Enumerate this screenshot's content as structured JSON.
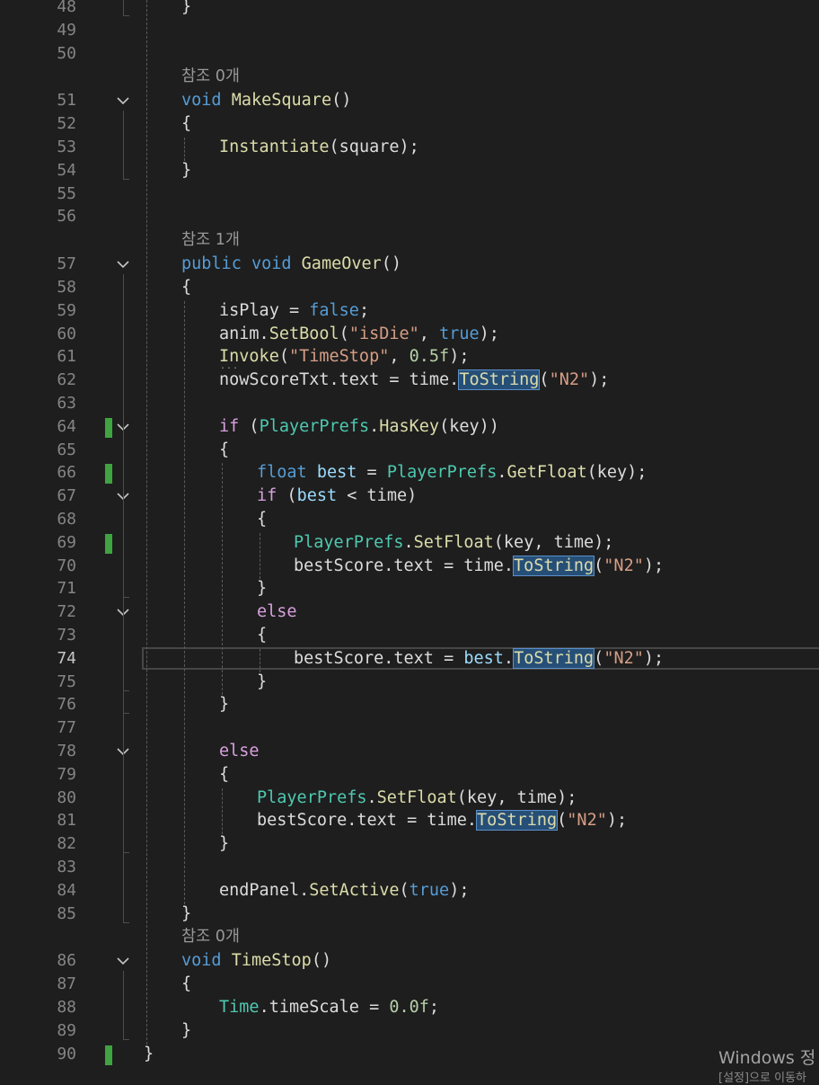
{
  "lines": [
    {
      "n": "48",
      "indent": 1,
      "tokens": [
        [
          "id",
          "}"
        ]
      ]
    },
    {
      "n": "49",
      "indent": 0,
      "tokens": []
    },
    {
      "n": "50",
      "indent": 0,
      "tokens": []
    },
    {
      "n": "51",
      "indent": 1,
      "fold": true,
      "lens": "참조 0개",
      "tokens": [
        [
          "kw",
          "void"
        ],
        [
          "id",
          " "
        ],
        [
          "fn",
          "MakeSquare"
        ],
        [
          "id",
          "()"
        ]
      ]
    },
    {
      "n": "52",
      "indent": 1,
      "tokens": [
        [
          "id",
          "{"
        ]
      ]
    },
    {
      "n": "53",
      "indent": 2,
      "tokens": [
        [
          "fn",
          "Instantiate"
        ],
        [
          "id",
          "(square);"
        ]
      ]
    },
    {
      "n": "54",
      "indent": 1,
      "tokens": [
        [
          "id",
          "}"
        ]
      ]
    },
    {
      "n": "55",
      "indent": 0,
      "tokens": []
    },
    {
      "n": "56",
      "indent": 0,
      "tokens": []
    },
    {
      "n": "57",
      "indent": 1,
      "fold": true,
      "lens": "참조 1개",
      "tokens": [
        [
          "kw",
          "public"
        ],
        [
          "id",
          " "
        ],
        [
          "kw",
          "void"
        ],
        [
          "id",
          " "
        ],
        [
          "fn",
          "GameOver"
        ],
        [
          "id",
          "()"
        ]
      ]
    },
    {
      "n": "58",
      "indent": 1,
      "tokens": [
        [
          "id",
          "{"
        ]
      ]
    },
    {
      "n": "59",
      "indent": 2,
      "tokens": [
        [
          "id",
          "isPlay = "
        ],
        [
          "kw",
          "false"
        ],
        [
          "id",
          ";"
        ]
      ]
    },
    {
      "n": "60",
      "indent": 2,
      "tokens": [
        [
          "id",
          "anim."
        ],
        [
          "fn",
          "SetBool"
        ],
        [
          "id",
          "("
        ],
        [
          "str",
          "\"isDie\""
        ],
        [
          "id",
          ", "
        ],
        [
          "kw",
          "true"
        ],
        [
          "id",
          ");"
        ]
      ]
    },
    {
      "n": "61",
      "indent": 2,
      "dots": true,
      "tokens": [
        [
          "fn",
          "Invoke"
        ],
        [
          "id",
          "("
        ],
        [
          "str",
          "\"TimeStop\""
        ],
        [
          "id",
          ", "
        ],
        [
          "num",
          "0.5f"
        ],
        [
          "id",
          ");"
        ]
      ]
    },
    {
      "n": "62",
      "indent": 2,
      "tokens": [
        [
          "id",
          "nowScoreTxt.text = time."
        ],
        [
          "fnhl",
          "ToString"
        ],
        [
          "id",
          "("
        ],
        [
          "str",
          "\"N2\""
        ],
        [
          "id",
          ");"
        ]
      ]
    },
    {
      "n": "63",
      "indent": 0,
      "tokens": []
    },
    {
      "n": "64",
      "indent": 2,
      "fold": true,
      "changed": true,
      "tokens": [
        [
          "ctl",
          "if"
        ],
        [
          "id",
          " ("
        ],
        [
          "ty",
          "PlayerPrefs"
        ],
        [
          "id",
          "."
        ],
        [
          "fn",
          "HasKey"
        ],
        [
          "id",
          "(key))"
        ]
      ]
    },
    {
      "n": "65",
      "indent": 2,
      "tokens": [
        [
          "id",
          "{"
        ]
      ]
    },
    {
      "n": "66",
      "indent": 3,
      "changed": true,
      "tokens": [
        [
          "kw",
          "float"
        ],
        [
          "id",
          " "
        ],
        [
          "var",
          "best"
        ],
        [
          "id",
          " = "
        ],
        [
          "ty",
          "PlayerPrefs"
        ],
        [
          "id",
          "."
        ],
        [
          "fn",
          "GetFloat"
        ],
        [
          "id",
          "(key);"
        ]
      ]
    },
    {
      "n": "67",
      "indent": 3,
      "fold": true,
      "tokens": [
        [
          "ctl",
          "if"
        ],
        [
          "id",
          " ("
        ],
        [
          "var",
          "best"
        ],
        [
          "id",
          " < time)"
        ]
      ]
    },
    {
      "n": "68",
      "indent": 3,
      "tokens": [
        [
          "id",
          "{"
        ]
      ]
    },
    {
      "n": "69",
      "indent": 4,
      "changed": true,
      "tokens": [
        [
          "ty",
          "PlayerPrefs"
        ],
        [
          "id",
          "."
        ],
        [
          "fn",
          "SetFloat"
        ],
        [
          "id",
          "(key, time);"
        ]
      ]
    },
    {
      "n": "70",
      "indent": 4,
      "tokens": [
        [
          "id",
          "bestScore.text = time."
        ],
        [
          "fnhl",
          "ToString"
        ],
        [
          "id",
          "("
        ],
        [
          "str",
          "\"N2\""
        ],
        [
          "id",
          ");"
        ]
      ]
    },
    {
      "n": "71",
      "indent": 3,
      "tokens": [
        [
          "id",
          "}"
        ]
      ]
    },
    {
      "n": "72",
      "indent": 3,
      "fold": true,
      "tokens": [
        [
          "ctl",
          "else"
        ]
      ]
    },
    {
      "n": "73",
      "indent": 3,
      "tokens": [
        [
          "id",
          "{"
        ]
      ]
    },
    {
      "n": "74",
      "indent": 4,
      "current": true,
      "tokens": [
        [
          "id",
          "bestScore.text = "
        ],
        [
          "var",
          "best"
        ],
        [
          "id",
          "."
        ],
        [
          "fnhl",
          "ToString"
        ],
        [
          "id",
          "("
        ],
        [
          "str",
          "\"N2\""
        ],
        [
          "id",
          ");"
        ]
      ]
    },
    {
      "n": "75",
      "indent": 3,
      "tokens": [
        [
          "id",
          "}"
        ]
      ]
    },
    {
      "n": "76",
      "indent": 2,
      "tokens": [
        [
          "id",
          "}"
        ]
      ]
    },
    {
      "n": "77",
      "indent": 0,
      "tokens": []
    },
    {
      "n": "78",
      "indent": 2,
      "fold": true,
      "tokens": [
        [
          "ctl",
          "else"
        ]
      ]
    },
    {
      "n": "79",
      "indent": 2,
      "tokens": [
        [
          "id",
          "{"
        ]
      ]
    },
    {
      "n": "80",
      "indent": 3,
      "tokens": [
        [
          "ty",
          "PlayerPrefs"
        ],
        [
          "id",
          "."
        ],
        [
          "fn",
          "SetFloat"
        ],
        [
          "id",
          "(key, time);"
        ]
      ]
    },
    {
      "n": "81",
      "indent": 3,
      "tokens": [
        [
          "id",
          "bestScore.text = time."
        ],
        [
          "fnhl",
          "ToString"
        ],
        [
          "id",
          "("
        ],
        [
          "str",
          "\"N2\""
        ],
        [
          "id",
          ");"
        ]
      ]
    },
    {
      "n": "82",
      "indent": 2,
      "tokens": [
        [
          "id",
          "}"
        ]
      ]
    },
    {
      "n": "83",
      "indent": 0,
      "tokens": []
    },
    {
      "n": "84",
      "indent": 2,
      "tokens": [
        [
          "id",
          "endPanel."
        ],
        [
          "fn",
          "SetActive"
        ],
        [
          "id",
          "("
        ],
        [
          "kw",
          "true"
        ],
        [
          "id",
          ");"
        ]
      ]
    },
    {
      "n": "85",
      "indent": 1,
      "tokens": [
        [
          "id",
          "}"
        ]
      ]
    },
    {
      "n": "86",
      "indent": 1,
      "fold": true,
      "lens": "참조 0개",
      "tokens": [
        [
          "kw",
          "void"
        ],
        [
          "id",
          " "
        ],
        [
          "fn",
          "TimeStop"
        ],
        [
          "id",
          "()"
        ]
      ]
    },
    {
      "n": "87",
      "indent": 1,
      "tokens": [
        [
          "id",
          "{"
        ]
      ]
    },
    {
      "n": "88",
      "indent": 2,
      "tokens": [
        [
          "ty",
          "Time"
        ],
        [
          "id",
          ".timeScale = "
        ],
        [
          "num",
          "0.0f"
        ],
        [
          "id",
          ";"
        ]
      ]
    },
    {
      "n": "89",
      "indent": 1,
      "tokens": [
        [
          "id",
          "}"
        ]
      ]
    },
    {
      "n": "90",
      "indent": 0,
      "changed": true,
      "tokens": [
        [
          "id",
          "}"
        ]
      ]
    }
  ],
  "watermark": {
    "line1": "Windows 정",
    "line2": "[설정]으로 이동하"
  }
}
